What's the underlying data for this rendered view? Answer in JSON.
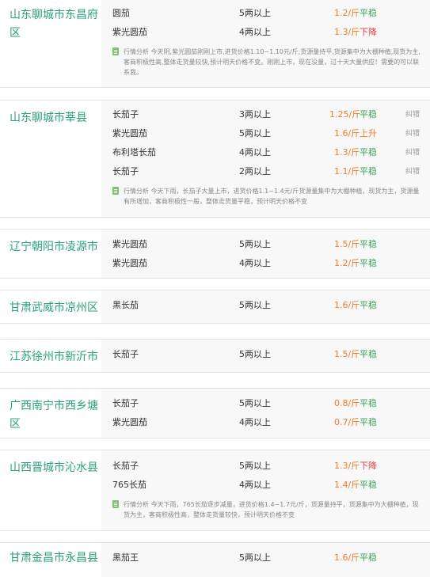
{
  "markets": [
    {
      "region": "山东聊城市东昌府区",
      "rows": [
        {
          "variety": "圆茄",
          "weight": "5两以上",
          "price": "1.2/斤",
          "trend": "平稳",
          "fix": ""
        },
        {
          "variety": "紫光圆茄",
          "weight": "4两以上",
          "price": "1.3/斤",
          "trend": "下降",
          "fix": ""
        }
      ],
      "analysis": "行情分析 今天阴,紫光圆茄刚刚上市,进货价格1.10~1.10元/斤,货源量持平,货源集中为大棚种植,现货为主,客商积极性高,整体走货量较快,预计明天价格不变。刚刚上市，现在没量，过十天大量供应！需要的可以联系我。"
    },
    {
      "region": "山东聊城市莘县",
      "rows": [
        {
          "variety": "长茄子",
          "weight": "3两以上",
          "price": "1.25/斤",
          "trend": "平稳",
          "fix": "纠错"
        },
        {
          "variety": "紫光圆茄",
          "weight": "5两以上",
          "price": "1.6/斤",
          "trend": "上升",
          "fix": "纠错"
        },
        {
          "variety": "布利塔长茄",
          "weight": "4两以上",
          "price": "1.3/斤",
          "trend": "平稳",
          "fix": "纠错"
        },
        {
          "variety": "长茄子",
          "weight": "2两以上",
          "price": "1.1/斤",
          "trend": "平稳",
          "fix": "纠错"
        }
      ],
      "analysis": "行情分析 今天下雨，长茄子大量上市，进货价格1.1~1.4元/斤货源量集中为大棚种植，现货为主，货源量有所增加，客商积极性一般，整体走货量平稳，预计明天价格不变"
    },
    {
      "region": "辽宁朝阳市凌源市",
      "rows": [
        {
          "variety": "紫光圆茄",
          "weight": "5两以上",
          "price": "1.5/斤",
          "trend": "平稳",
          "fix": ""
        },
        {
          "variety": "紫光圆茄",
          "weight": "4两以上",
          "price": "1.2/斤",
          "trend": "平稳",
          "fix": ""
        }
      ],
      "analysis": ""
    },
    {
      "region": "甘肃武威市凉州区",
      "rows": [
        {
          "variety": "黑长茄",
          "weight": "5两以上",
          "price": "1.6/斤",
          "trend": "平稳",
          "fix": ""
        }
      ],
      "analysis": ""
    },
    {
      "region": "江苏徐州市新沂市",
      "rows": [
        {
          "variety": "长茄子",
          "weight": "5两以上",
          "price": "1.5/斤",
          "trend": "平稳",
          "fix": ""
        }
      ],
      "analysis": ""
    },
    {
      "region": "广西南宁市西乡塘区",
      "rows": [
        {
          "variety": "长茄子",
          "weight": "5两以上",
          "price": "0.8/斤",
          "trend": "平稳",
          "fix": ""
        },
        {
          "variety": "紫光圆茄",
          "weight": "4两以上",
          "price": "0.7/斤",
          "trend": "平稳",
          "fix": ""
        }
      ],
      "analysis": ""
    },
    {
      "region": "山西晋城市沁水县",
      "rows": [
        {
          "variety": "长茄子",
          "weight": "5两以上",
          "price": "1.3/斤",
          "trend": "下降",
          "fix": ""
        },
        {
          "variety": "765长茄",
          "weight": "4两以上",
          "price": "1.4/斤",
          "trend": "平稳",
          "fix": ""
        }
      ],
      "analysis": "行情分析 今天下雨，765长茄逐步减量，进货价格1.4~1.7元/斤，货源量持平，货源集中为大棚种植，现货为主，客商积极性高，整体走货量较快，预计明天价格不变"
    },
    {
      "region": "甘肃金昌市永昌县",
      "rows": [
        {
          "variety": "黑茄王",
          "weight": "5两以上",
          "price": "1.6/斤",
          "trend": "平稳",
          "fix": ""
        }
      ],
      "analysis": ""
    }
  ]
}
